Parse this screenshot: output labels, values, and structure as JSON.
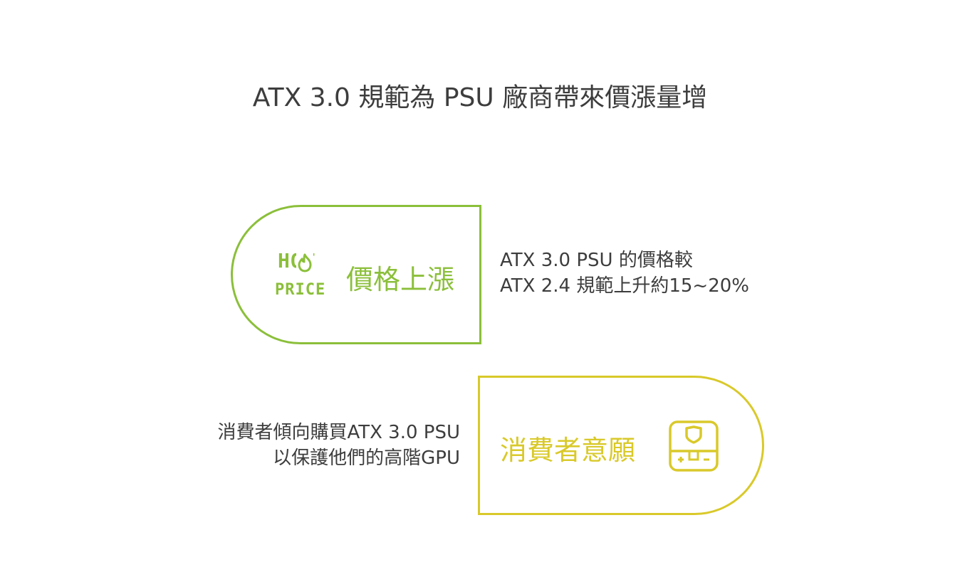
{
  "title": "ATX 3.0 規範為 PSU 廠商帶來價漲量增",
  "colors": {
    "green": "#8bbf3a",
    "yellow": "#d9c92a",
    "text": "#3d3d3d"
  },
  "blocks": [
    {
      "label": "價格上漲",
      "badge_line1": "HOT",
      "badge_line2": "PRICE",
      "icon": "hot-price-flame-icon",
      "desc_lines": [
        "ATX 3.0 PSU 的價格較",
        "ATX 2.4 規範上升約15~20%"
      ]
    },
    {
      "label": "消費者意願",
      "icon": "game-console-shield-icon",
      "desc_lines": [
        "消費者傾向購買ATX 3.0 PSU",
        "以保護他們的高階GPU"
      ]
    }
  ]
}
